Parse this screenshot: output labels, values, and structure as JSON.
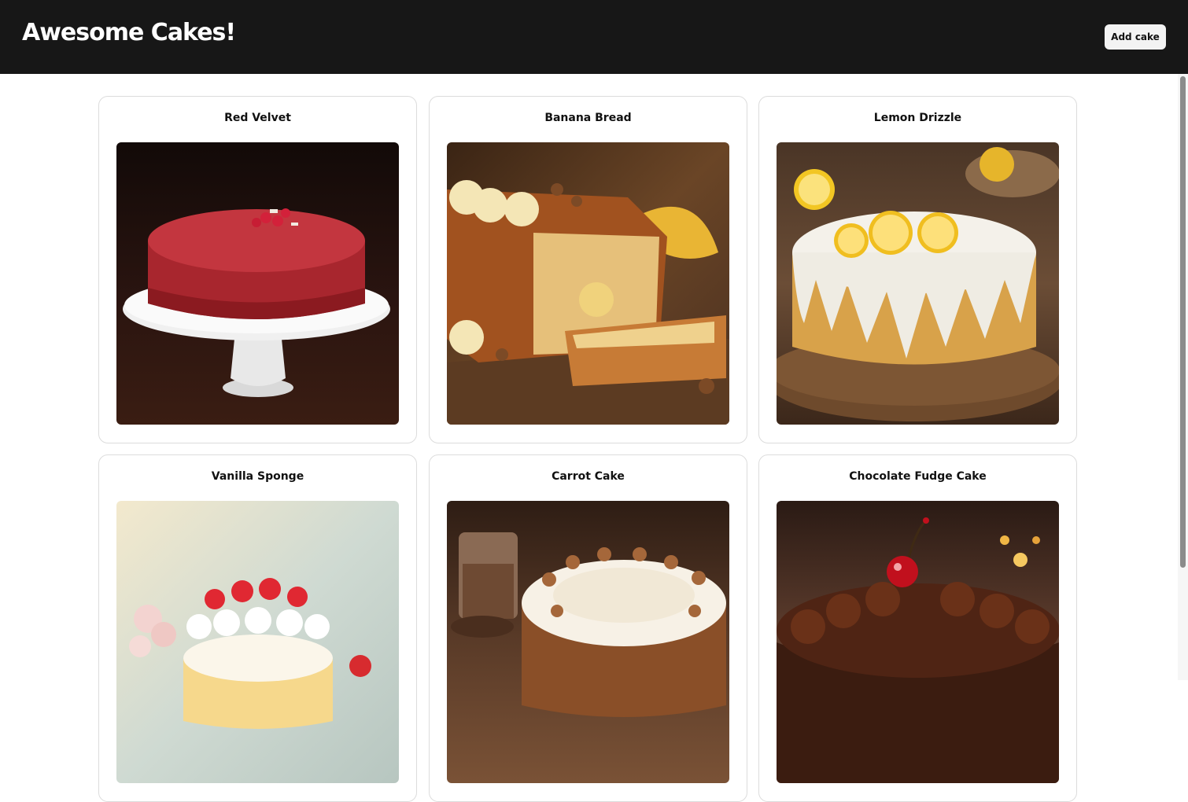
{
  "header": {
    "title": "Awesome Cakes!",
    "add_button_label": "Add cake"
  },
  "cakes": [
    {
      "name": "Red Velvet"
    },
    {
      "name": "Banana Bread"
    },
    {
      "name": "Lemon Drizzle"
    },
    {
      "name": "Vanilla Sponge"
    },
    {
      "name": "Carrot Cake"
    },
    {
      "name": "Chocolate Fudge Cake"
    }
  ],
  "colors": {
    "header_bg": "#171717",
    "button_bg": "#f3f3f3",
    "card_border": "#dcdcdc"
  }
}
